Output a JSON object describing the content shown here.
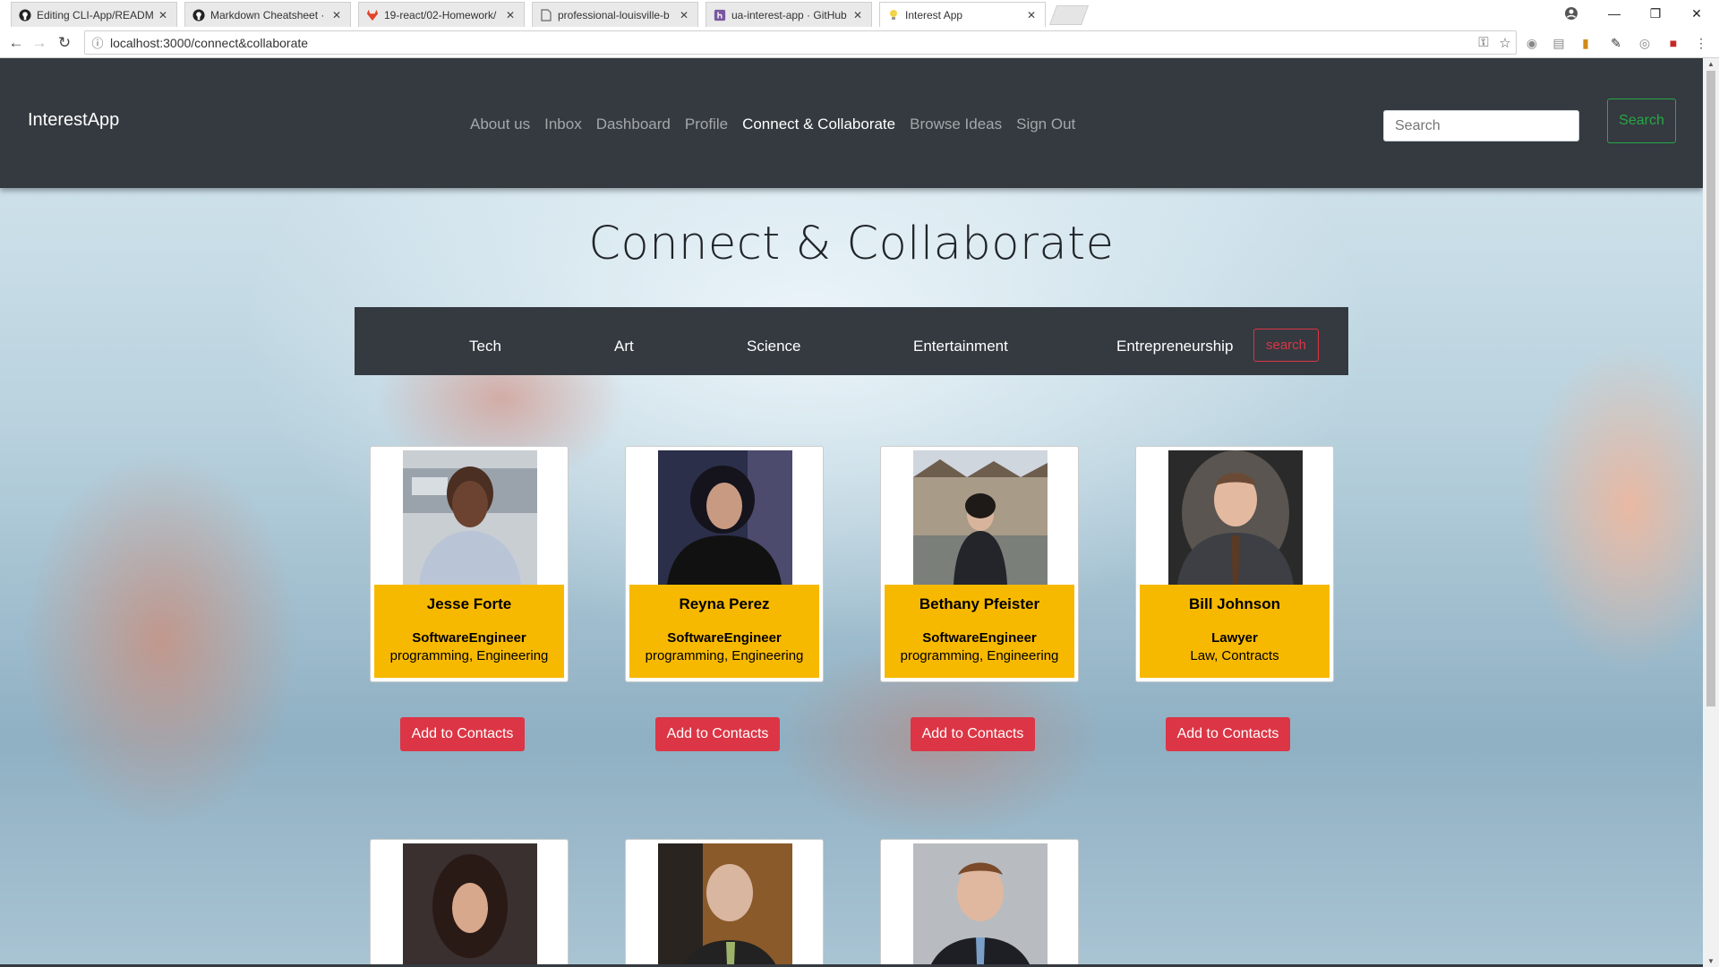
{
  "browser": {
    "tabs": [
      {
        "title": "Editing CLI-App/READM",
        "icon": "github-icon"
      },
      {
        "title": "Markdown Cheatsheet ·",
        "icon": "github-icon"
      },
      {
        "title": "19-react/02-Homework/",
        "icon": "gitlab-icon"
      },
      {
        "title": "professional-louisville-b",
        "icon": "document-icon"
      },
      {
        "title": "ua-interest-app · GitHub",
        "icon": "heroku-icon"
      },
      {
        "title": "Interest App",
        "icon": "bulb-icon"
      }
    ],
    "url": "localhost:3000/connect&collaborate"
  },
  "nav": {
    "brand": "InterestApp",
    "links": [
      "About us",
      "Inbox",
      "Dashboard",
      "Profile",
      "Connect & Collaborate",
      "Browse Ideas",
      "Sign Out"
    ],
    "active_link": "Connect & Collaborate",
    "search_placeholder": "Search",
    "search_button": "Search"
  },
  "page": {
    "title": "Connect & Collaborate",
    "categories": [
      "Tech",
      "Art",
      "Science",
      "Entertainment",
      "Entrepreneurship"
    ],
    "category_search_button": "search"
  },
  "cards": [
    {
      "name": "Jesse Forte",
      "role": "SoftwareEngineer",
      "tags": "programming, Engineering",
      "button": "Add to Contacts"
    },
    {
      "name": "Reyna Perez",
      "role": "SoftwareEngineer",
      "tags": "programming, Engineering",
      "button": "Add to Contacts"
    },
    {
      "name": "Bethany Pfeister",
      "role": "SoftwareEngineer",
      "tags": "programming, Engineering",
      "button": "Add to Contacts"
    },
    {
      "name": "Bill Johnson",
      "role": "Lawyer",
      "tags": "Law, Contracts",
      "button": "Add to Contacts"
    }
  ],
  "colors": {
    "navbar": "#343a40",
    "card_info": "#f7b900",
    "danger": "#dc3545",
    "success": "#28a745"
  }
}
